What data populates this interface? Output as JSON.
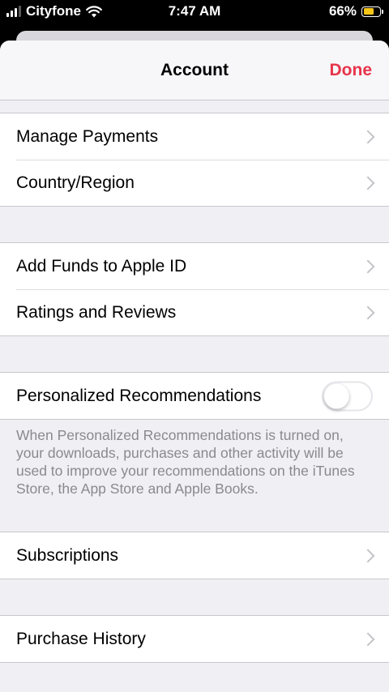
{
  "status_bar": {
    "carrier": "Cityfone",
    "time": "7:47 AM",
    "battery_percent": "66%",
    "battery_level": 0.66,
    "battery_color": "#f5c518",
    "icons": [
      "signal-icon",
      "wifi-icon",
      "battery-icon"
    ]
  },
  "nav": {
    "title": "Account",
    "done_label": "Done",
    "accent_color": "#e8344b"
  },
  "groups": {
    "payments": {
      "manage_payments": "Manage Payments",
      "country_region": "Country/Region"
    },
    "funds": {
      "add_funds": "Add Funds to Apple ID",
      "ratings_reviews": "Ratings and Reviews"
    },
    "personalized": {
      "label": "Personalized Recommendations",
      "toggle_on": false,
      "note": "When Personalized Recommendations is turned on, your downloads, purchases and other activity will be used to improve your recommendations on the iTunes Store, the App Store and Apple Books."
    },
    "subscriptions": {
      "label": "Subscriptions"
    },
    "purchase_history": {
      "label": "Purchase History"
    }
  }
}
